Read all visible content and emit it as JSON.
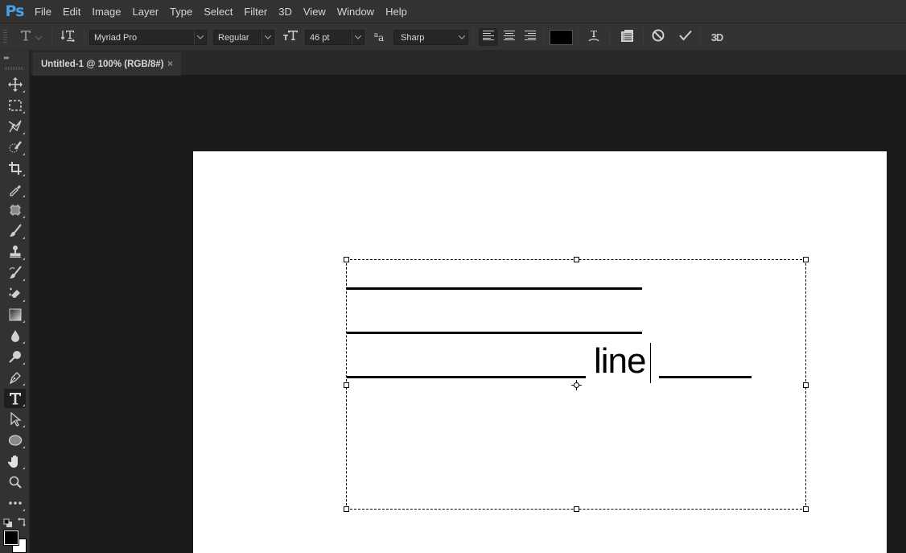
{
  "app": {
    "logo": "Ps",
    "menu": [
      "File",
      "Edit",
      "Image",
      "Layer",
      "Type",
      "Select",
      "Filter",
      "3D",
      "View",
      "Window",
      "Help"
    ]
  },
  "options_bar": {
    "tool_preset_icon": "type-tool-icon",
    "orientation_toggle_icon": "text-orientation-icon",
    "font_family": "Myriad Pro",
    "font_style": "Regular",
    "font_size_icon": "font-size-icon",
    "font_size": "46 pt",
    "antialias_icon": "antialias-icon",
    "antialias": "Sharp",
    "align": [
      "left",
      "center",
      "right"
    ],
    "align_active": "left",
    "text_color": "#000000",
    "warp_icon": "warp-text-icon",
    "panels_icon": "character-paragraph-panels-icon",
    "cancel_icon": "cancel-icon",
    "commit_icon": "commit-checkmark-icon",
    "threed_label": "3D"
  },
  "document_tab": {
    "title": "Untitled-1 @ 100% (RGB/8#)",
    "close": "×"
  },
  "toolbox": {
    "collapse": "▸▸",
    "tools": [
      "move-tool",
      "rectangular-marquee-tool",
      "polygonal-lasso-tool",
      "quick-selection-tool",
      "crop-tool",
      "eyedropper-tool",
      "frame-tool",
      "brush-tool",
      "clone-stamp-tool",
      "history-brush-tool",
      "eraser-tool",
      "gradient-tool",
      "blur-tool",
      "dodge-tool",
      "pen-tool",
      "type-tool",
      "path-selection-tool",
      "ellipse-tool",
      "hand-tool",
      "zoom-tool",
      "edit-toolbar"
    ],
    "active_tool": "type-tool",
    "foreground_color": "#000000",
    "background_color": "#ffffff"
  },
  "canvas": {
    "background": "#ffffff",
    "text_layer": {
      "line1": "_____________________",
      "line2": "_____________________",
      "line3_prefix": "_________________",
      "typed_word": "line",
      "line3_suffix": "______"
    }
  }
}
